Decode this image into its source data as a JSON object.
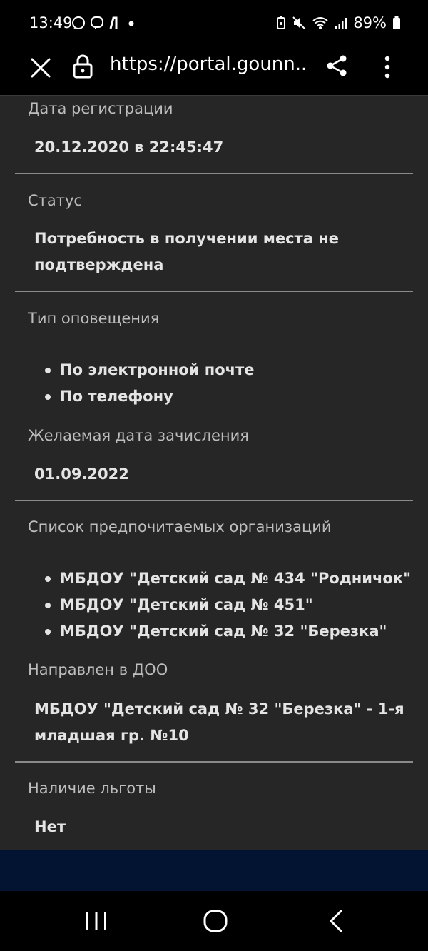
{
  "status_bar": {
    "time": "13:49",
    "left_icons": [
      "whatsapp-icon",
      "viber-icon",
      "app-notification-icon",
      "dot-icon"
    ],
    "right_icons": [
      "battery-saver-icon",
      "mute-icon",
      "wifi-icon",
      "signal-icon",
      "battery-icon"
    ],
    "battery": "89%"
  },
  "browser": {
    "url": "https://portal.gounn....",
    "icons": [
      "close-icon",
      "lock-icon",
      "share-icon",
      "more-vert-icon"
    ]
  },
  "fields": {
    "reg_date": {
      "label": "Дата регистрации",
      "value": "20.12.2020 в 22:45:47"
    },
    "status": {
      "label": "Статус",
      "value": "Потребность в получении места не подтверждена"
    },
    "notify": {
      "label": "Тип оповещения",
      "items": [
        "По электронной почте",
        "По телефону"
      ]
    },
    "desired_date": {
      "label": "Желаемая дата зачисления",
      "value": "01.09.2022"
    },
    "orgs": {
      "label": "Список предпочитаемых организаций",
      "items": [
        "МБДОУ \"Детский сад № 434 \"Родничок\"",
        "МБДОУ \"Детский сад № 451\"",
        "МБДОУ \"Детский сад № 32 \"Березка\""
      ]
    },
    "directed": {
      "label": "Направлен в ДОО",
      "value": "МБДОУ \"Детский сад № 32 \"Березка\" - 1-я младшая гр. №10"
    },
    "benefit": {
      "label": "Наличие льготы",
      "value": "Нет"
    }
  },
  "nav": {
    "icons": [
      "recent-apps-icon",
      "home-icon",
      "back-icon"
    ]
  },
  "colors": {
    "background": "#262626",
    "footer": "#021431",
    "bar": "#000000"
  }
}
